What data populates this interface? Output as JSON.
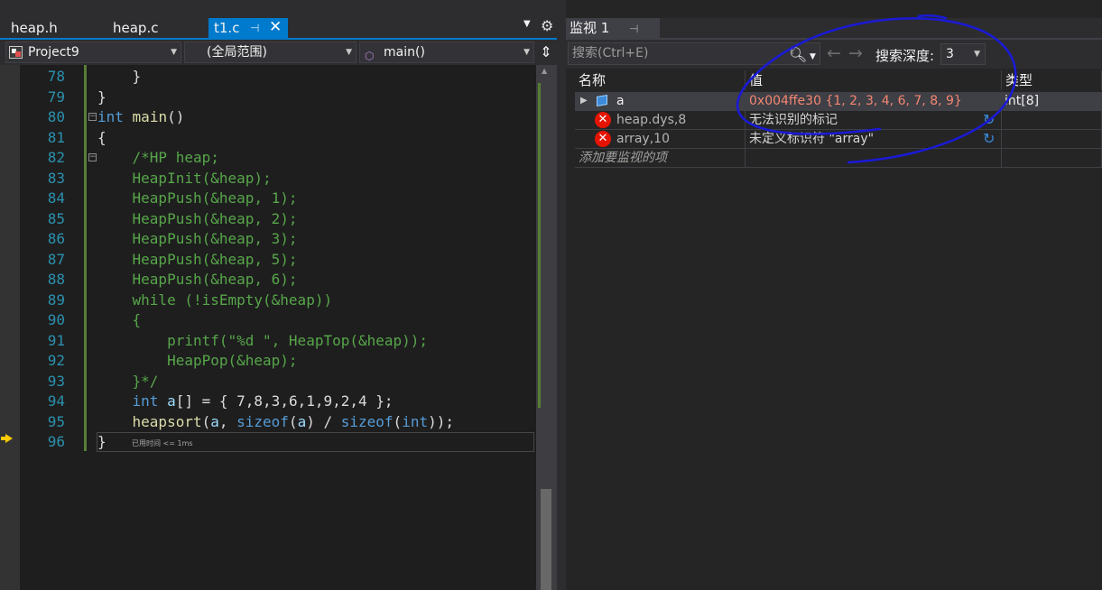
{
  "editor": {
    "tabs": [
      {
        "label": "heap.h",
        "active": false
      },
      {
        "label": "heap.c",
        "active": false
      },
      {
        "label": "t1.c",
        "active": true,
        "pin_icon": "pin-icon",
        "close_icon": "close-icon"
      }
    ],
    "nav": {
      "project": "Project9",
      "scope": "(全局范围)",
      "member": "main()"
    },
    "lines": [
      {
        "num": "78",
        "tokens": [
          {
            "t": "    }",
            "c": "tx"
          }
        ]
      },
      {
        "num": "79",
        "tokens": [
          {
            "t": "}",
            "c": "tx"
          }
        ]
      },
      {
        "num": "80",
        "tokens": [
          {
            "t": "int",
            "c": "kw"
          },
          {
            "t": " ",
            "c": "tx"
          },
          {
            "t": "main",
            "c": "fn"
          },
          {
            "t": "()",
            "c": "tx"
          }
        ]
      },
      {
        "num": "81",
        "tokens": [
          {
            "t": "{",
            "c": "tx"
          }
        ]
      },
      {
        "num": "82",
        "tokens": [
          {
            "t": "    /*HP heap;",
            "c": "cm"
          }
        ]
      },
      {
        "num": "83",
        "tokens": [
          {
            "t": "    HeapInit(&heap);",
            "c": "cm"
          }
        ]
      },
      {
        "num": "84",
        "tokens": [
          {
            "t": "    HeapPush(&heap, 1);",
            "c": "cm"
          }
        ]
      },
      {
        "num": "85",
        "tokens": [
          {
            "t": "    HeapPush(&heap, 2);",
            "c": "cm"
          }
        ]
      },
      {
        "num": "86",
        "tokens": [
          {
            "t": "    HeapPush(&heap, 3);",
            "c": "cm"
          }
        ]
      },
      {
        "num": "87",
        "tokens": [
          {
            "t": "    HeapPush(&heap, 5);",
            "c": "cm"
          }
        ]
      },
      {
        "num": "88",
        "tokens": [
          {
            "t": "    HeapPush(&heap, 6);",
            "c": "cm"
          }
        ]
      },
      {
        "num": "89",
        "tokens": [
          {
            "t": "    while (!isEmpty(&heap))",
            "c": "cm"
          }
        ]
      },
      {
        "num": "90",
        "tokens": [
          {
            "t": "    {",
            "c": "cm"
          }
        ]
      },
      {
        "num": "91",
        "tokens": [
          {
            "t": "        printf(\"%d \", HeapTop(&heap));",
            "c": "cm"
          }
        ]
      },
      {
        "num": "92",
        "tokens": [
          {
            "t": "        HeapPop(&heap);",
            "c": "cm"
          }
        ]
      },
      {
        "num": "93",
        "tokens": [
          {
            "t": "    }*/",
            "c": "cm"
          }
        ]
      },
      {
        "num": "94",
        "tokens": [
          {
            "t": "    ",
            "c": "tx"
          },
          {
            "t": "int",
            "c": "kw"
          },
          {
            "t": " ",
            "c": "tx"
          },
          {
            "t": "a",
            "c": "id"
          },
          {
            "t": "[] = { 7,8,3,6,1,9,2,4 };",
            "c": "tx"
          }
        ]
      },
      {
        "num": "95",
        "tokens": [
          {
            "t": "    ",
            "c": "tx"
          },
          {
            "t": "heapsort",
            "c": "fn"
          },
          {
            "t": "(",
            "c": "tx"
          },
          {
            "t": "a",
            "c": "id"
          },
          {
            "t": ", ",
            "c": "tx"
          },
          {
            "t": "sizeof",
            "c": "kw"
          },
          {
            "t": "(",
            "c": "tx"
          },
          {
            "t": "a",
            "c": "id"
          },
          {
            "t": ") / ",
            "c": "tx"
          },
          {
            "t": "sizeof",
            "c": "kw"
          },
          {
            "t": "(",
            "c": "tx"
          },
          {
            "t": "int",
            "c": "kw"
          },
          {
            "t": "));",
            "c": "tx"
          }
        ]
      },
      {
        "num": "96",
        "tokens": [
          {
            "t": "}",
            "c": "tx"
          }
        ]
      }
    ],
    "perf_tip": "已用时间 <= 1ms"
  },
  "watch": {
    "title": "监视 1",
    "search_placeholder": "搜索(Ctrl+E)",
    "depth_label": "搜索深度:",
    "depth_value": "3",
    "columns": [
      "名称",
      "值",
      "类型"
    ],
    "rows": [
      {
        "name": "a",
        "value": "0x004ffe30 {1, 2, 3, 4, 6, 7, 8, 9}",
        "type": "int[8]",
        "kind": "var",
        "value_color": "red"
      },
      {
        "name": "heap.dys,8",
        "value": "无法识别的标记",
        "type": "",
        "kind": "error",
        "value_color": "gray"
      },
      {
        "name": "array,10",
        "value": "未定义标识符 \"array\"",
        "type": "",
        "kind": "error",
        "value_color": "gray"
      }
    ],
    "add_item_label": "添加要监视的项"
  },
  "colors": {
    "accent": "#007acc",
    "keyword": "#569cd6",
    "function": "#dcdcaa",
    "comment": "#57a64a",
    "line_number": "#2b91af",
    "error_value": "#f48771",
    "annotation_ink": "#1a1ad8"
  }
}
